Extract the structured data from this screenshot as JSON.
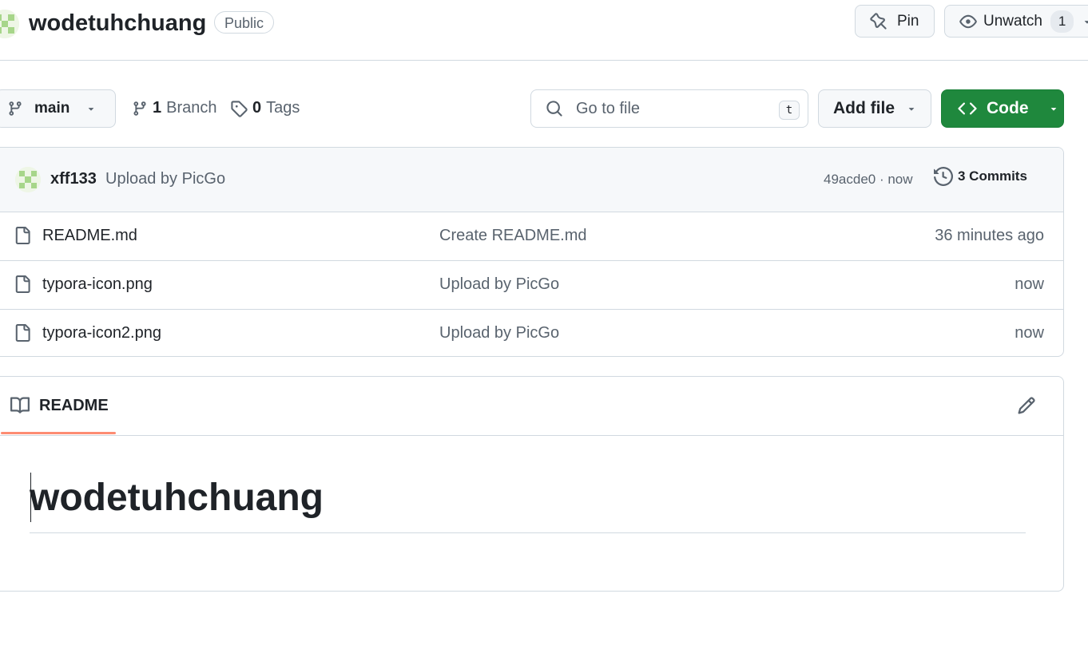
{
  "repo": {
    "name": "wodetuhchuang",
    "visibility": "Public"
  },
  "header_actions": {
    "pin_label": "Pin",
    "unwatch_label": "Unwatch",
    "watch_count": "1"
  },
  "branch_bar": {
    "current_branch": "main",
    "branch_count": "1",
    "branch_label": "Branch",
    "tag_count": "0",
    "tag_label": "Tags",
    "search_placeholder": "Go to file",
    "search_shortcut": "t",
    "add_file_label": "Add file",
    "code_label": "Code"
  },
  "latest_commit": {
    "author": "xff133",
    "message": "Upload by PicGo",
    "meta": "49acde0 · now",
    "commits_label": "3 Commits"
  },
  "files": [
    {
      "name": "README.md",
      "commit": "Create README.md",
      "age": "36 minutes ago"
    },
    {
      "name": "typora-icon.png",
      "commit": "Upload by PicGo",
      "age": "now"
    },
    {
      "name": "typora-icon2.png",
      "commit": "Upload by PicGo",
      "age": "now"
    }
  ],
  "readme": {
    "tab_label": "README",
    "heading": "wodetuhchuang"
  },
  "colors": {
    "code_button": "#1f883d",
    "tab_underline": "#fd8c73",
    "border": "#d1d9e0"
  }
}
